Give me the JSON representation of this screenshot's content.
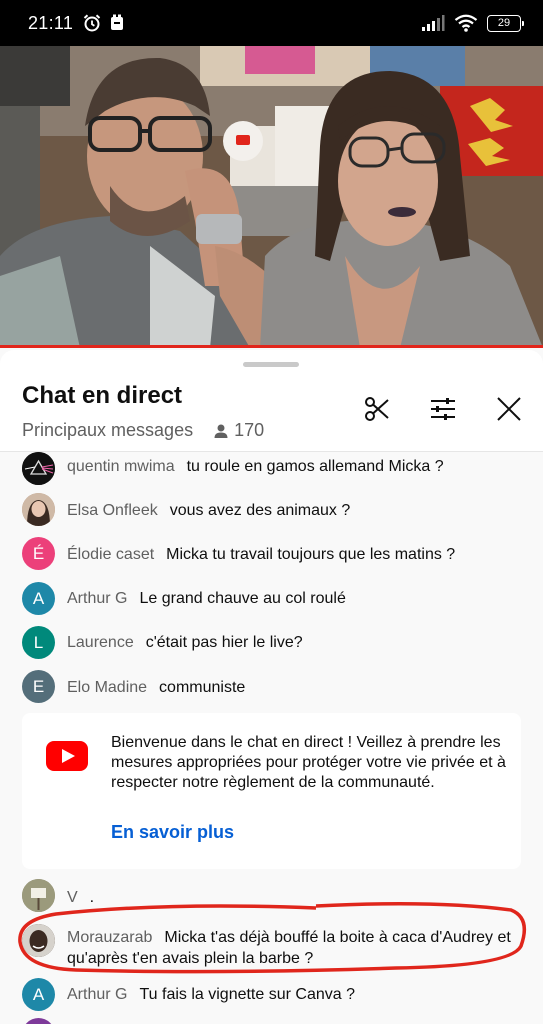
{
  "status_bar": {
    "time": "21:11",
    "battery": "29",
    "icons": [
      "alarm-icon",
      "notification-icon",
      "signal-icon",
      "wifi-icon",
      "battery-icon"
    ]
  },
  "chat": {
    "title": "Chat en direct",
    "mode": "Principaux messages",
    "viewers": "170",
    "header_icons": [
      "scissors-icon",
      "filter-sliders-icon",
      "close-icon"
    ]
  },
  "messages": [
    {
      "author": "quentin mwima",
      "text": "tu roule en gamos allemand Micka ?",
      "avatar_letter": "",
      "avatar_color": "#222222"
    },
    {
      "author": "Elsa Onfleek",
      "text": "vous avez des animaux ?",
      "avatar_letter": "",
      "avatar_color": "#b7977f"
    },
    {
      "author": "Élodie caset",
      "text": "Micka tu travail toujours que les matins ?",
      "avatar_letter": "É",
      "avatar_color": "#ec407a"
    },
    {
      "author": "Arthur G",
      "text": "Le grand chauve au col roulé",
      "avatar_letter": "A",
      "avatar_color": "#1e88a8"
    },
    {
      "author": "Laurence",
      "text": "c'était pas hier le live?",
      "avatar_letter": "L",
      "avatar_color": "#00897b"
    },
    {
      "author": "Elo Madine",
      "text": "communiste",
      "avatar_letter": "E",
      "avatar_color": "#546e7a"
    }
  ],
  "welcome": {
    "text": "Bienvenue dans le chat en direct ! Veillez à prendre les mesures appropriées pour protéger votre vie privée et à respecter notre règlement de la communauté.",
    "link": "En savoir plus"
  },
  "messages_after": [
    {
      "author": "V",
      "text": ".",
      "avatar_letter": "",
      "avatar_color": "#8d8a6e"
    },
    {
      "author": "Morauzarab",
      "text": "Micka t'as déjà bouffé la boite à caca d'Audrey et qu'après t'en avais plein la barbe ?",
      "avatar_letter": "",
      "avatar_color": "#3e2f28"
    },
    {
      "author": "Arthur G",
      "text": "Tu fais la vignette sur Canva ?",
      "avatar_letter": "A",
      "avatar_color": "#1e88a8"
    }
  ],
  "colors": {
    "accent_red": "#e1251b",
    "link_blue": "#065fd4",
    "annotation_red": "#e0261c"
  }
}
